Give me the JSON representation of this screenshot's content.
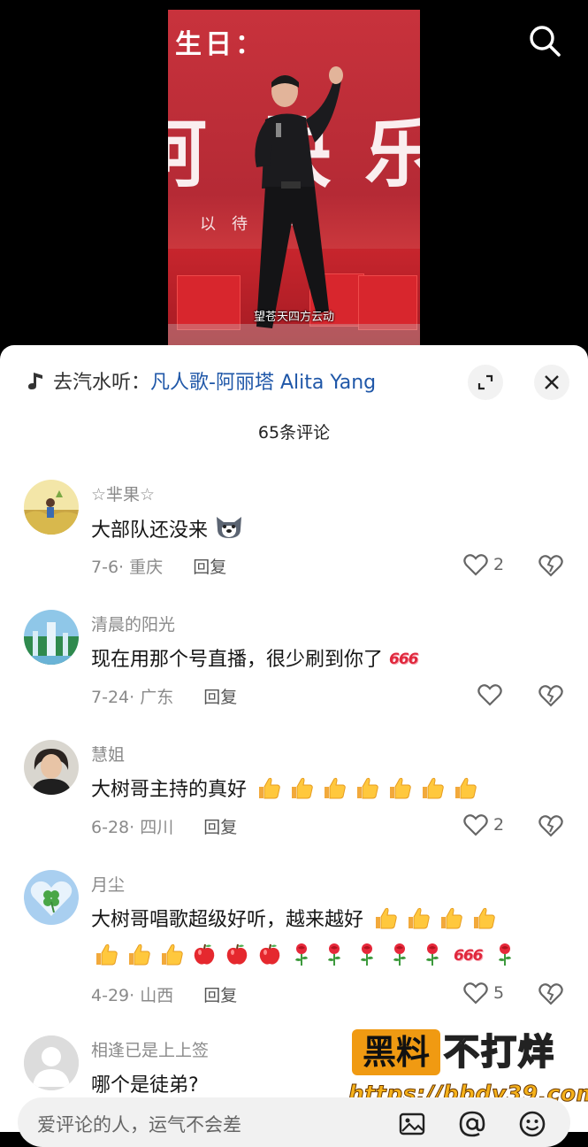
{
  "video": {
    "title_text": "生日：",
    "big_chars": [
      "阿",
      "快",
      "乐"
    ],
    "subline": "以待 共",
    "subtitle": "望苍天四方云动"
  },
  "music": {
    "prefix": "去汽水听：",
    "song": "凡人歌-阿丽塔 Alita Yang",
    "icon": "music-note-icon"
  },
  "comment_count": "65条评论",
  "comments": [
    {
      "name": "☆芈果☆",
      "text": "大部队还没来",
      "date": "7-6",
      "location": "重庆",
      "reply": "回复",
      "likes": "2"
    },
    {
      "name": "清晨的阳光",
      "text": "现在用那个号直播，很少刷到你了",
      "date": "7-24",
      "location": "广东",
      "reply": "回复",
      "likes": ""
    },
    {
      "name": "慧姐",
      "text": "大树哥主持的真好",
      "date": "6-28",
      "location": "四川",
      "reply": "回复",
      "likes": "2"
    },
    {
      "name": "月尘",
      "text": "大树哥唱歌超级好听，越来越好",
      "date": "4-29",
      "location": "山西",
      "reply": "回复",
      "likes": "5"
    },
    {
      "name": "相逢已是上上签",
      "text": "哪个是徒弟?"
    }
  ],
  "emoji_text": {
    "six": "666"
  },
  "watermark": {
    "badge": "黑料",
    "rest": "不打烊",
    "url": "https://bbdy39.com"
  },
  "input": {
    "placeholder": "爱评论的人，运气不会差"
  },
  "colors": {
    "link": "#1f57a8",
    "accent_red": "#e0283d",
    "watermark_orange": "#f09a12"
  }
}
